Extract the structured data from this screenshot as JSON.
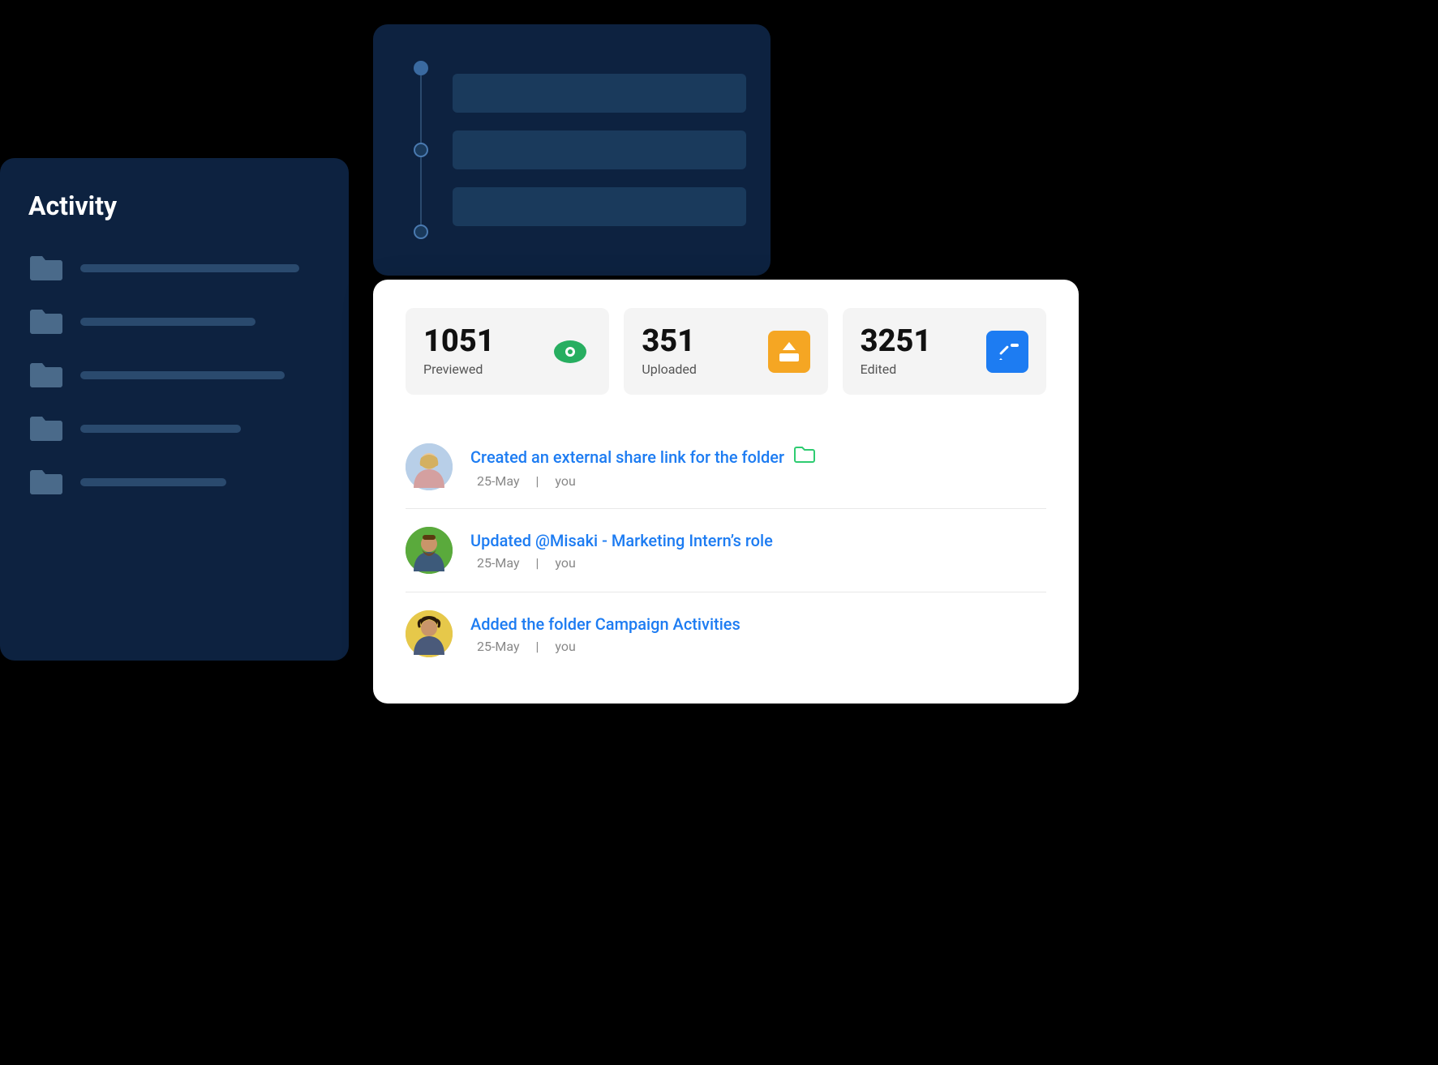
{
  "timeline_panel": {
    "dots": [
      "filled",
      "empty",
      "empty"
    ],
    "bars": 3
  },
  "activity_panel": {
    "title": "Activity",
    "folders": [
      {
        "bar_width": "75%"
      },
      {
        "bar_width": "60%"
      },
      {
        "bar_width": "70%"
      },
      {
        "bar_width": "55%"
      },
      {
        "bar_width": "50%"
      }
    ]
  },
  "stats": [
    {
      "number": "1051",
      "label": "Previewed",
      "icon_type": "green"
    },
    {
      "number": "351",
      "label": "Uploaded",
      "icon_type": "orange"
    },
    {
      "number": "3251",
      "label": "Edited",
      "icon_type": "blue"
    }
  ],
  "activities": [
    {
      "text": "Created an external share link for the folder",
      "date": "25-May",
      "actor": "you",
      "icon": "folder"
    },
    {
      "text": "Updated @Misaki - Marketing Intern’s role",
      "date": "25-May",
      "actor": "you",
      "icon": null
    },
    {
      "text": "Added the folder Campaign Activities",
      "date": "25-May",
      "actor": "you",
      "icon": null
    }
  ]
}
